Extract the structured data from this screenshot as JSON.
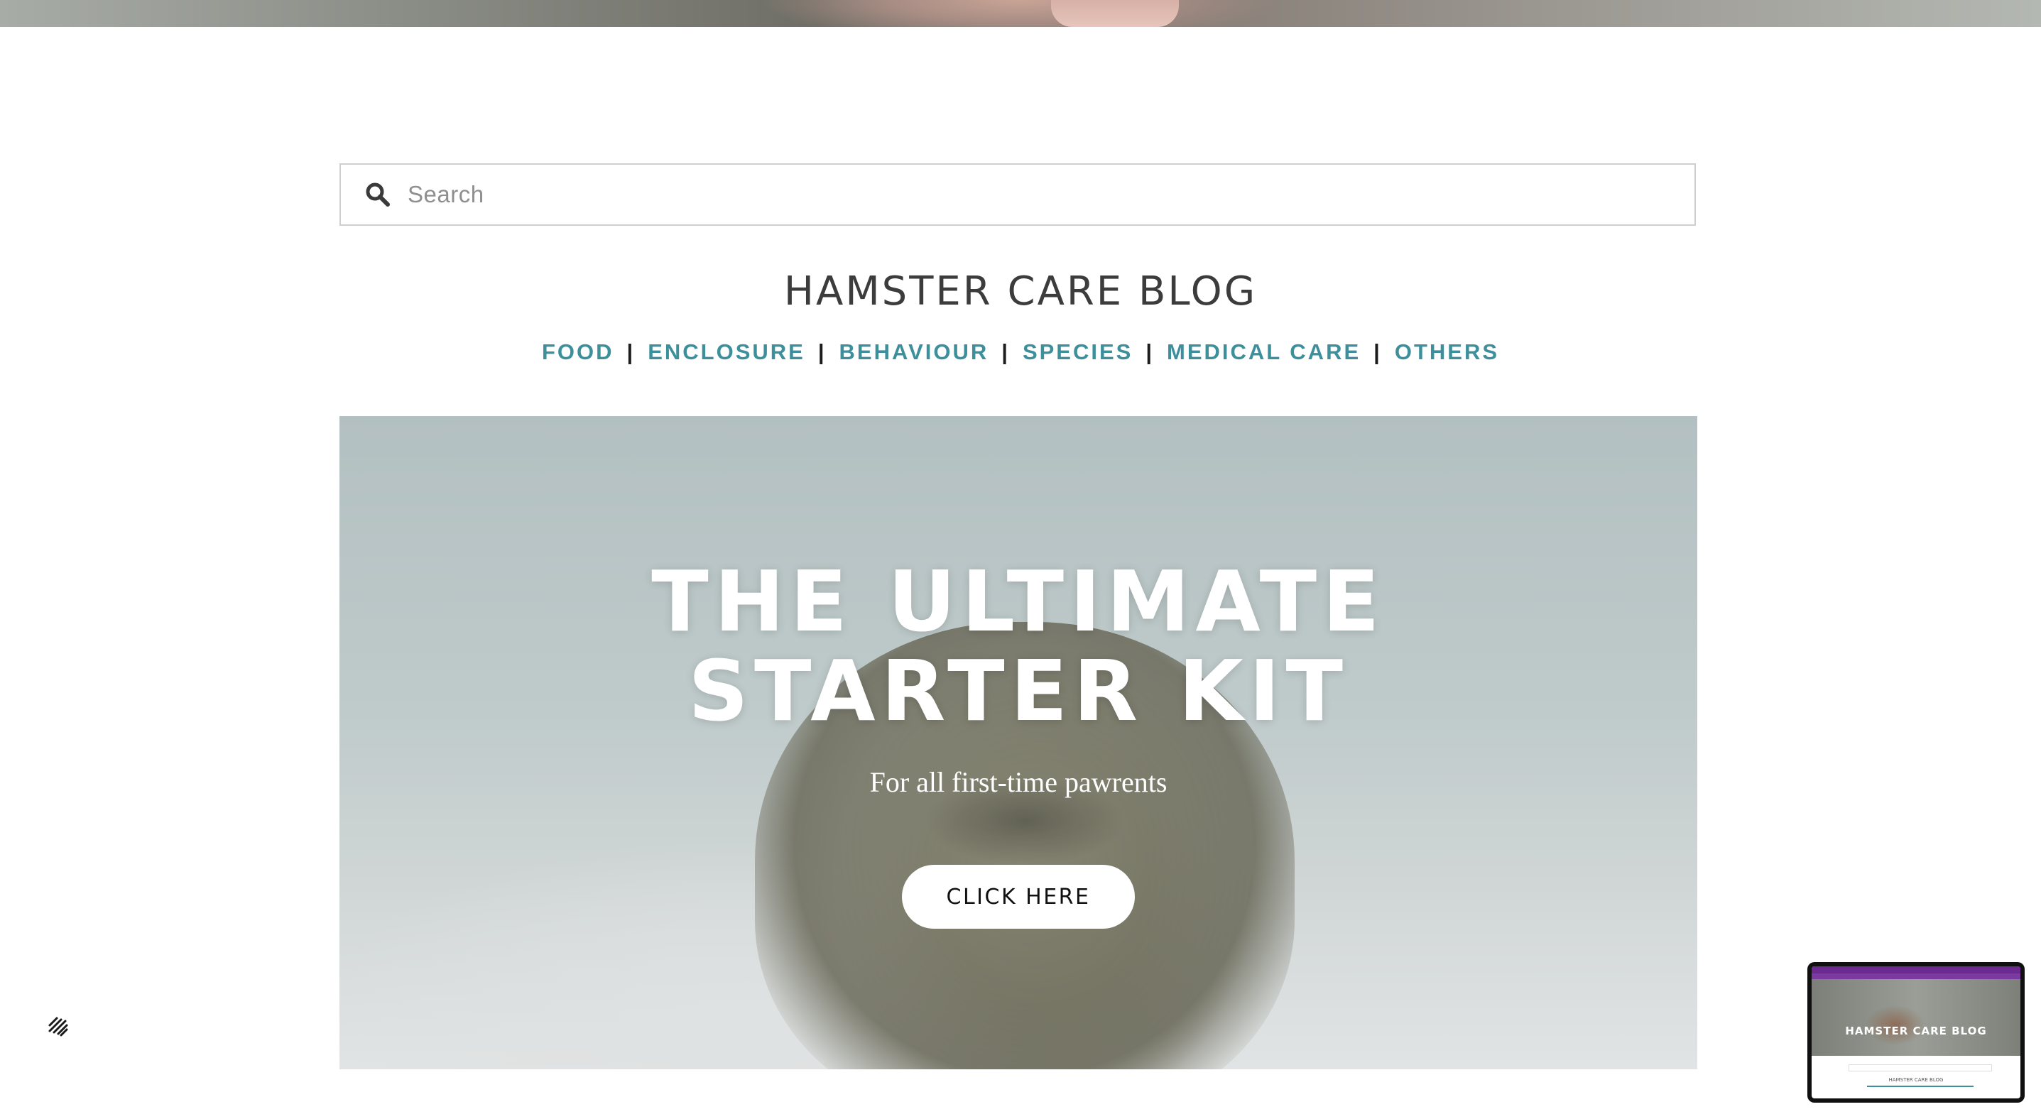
{
  "search": {
    "placeholder": "Search"
  },
  "site": {
    "title": "HAMSTER CARE BLOG"
  },
  "nav": {
    "items": [
      "FOOD",
      "ENCLOSURE",
      "BEHAVIOUR",
      "SPECIES",
      "MEDICAL CARE",
      "OTHERS"
    ],
    "separator": "|",
    "link_color": "#3e8f9c"
  },
  "hero": {
    "title_line1": "THE ULTIMATE",
    "title_line2": "STARTER KIT",
    "subtitle": "For all first-time pawrents",
    "button_label": "CLICK HERE"
  },
  "thumbnail": {
    "title": "HAMSTER CARE BLOG",
    "small_title": "HAMSTER CARE BLOG"
  },
  "icons": {
    "search": "search-icon",
    "platform_logo": "squarespace-logo-icon"
  }
}
